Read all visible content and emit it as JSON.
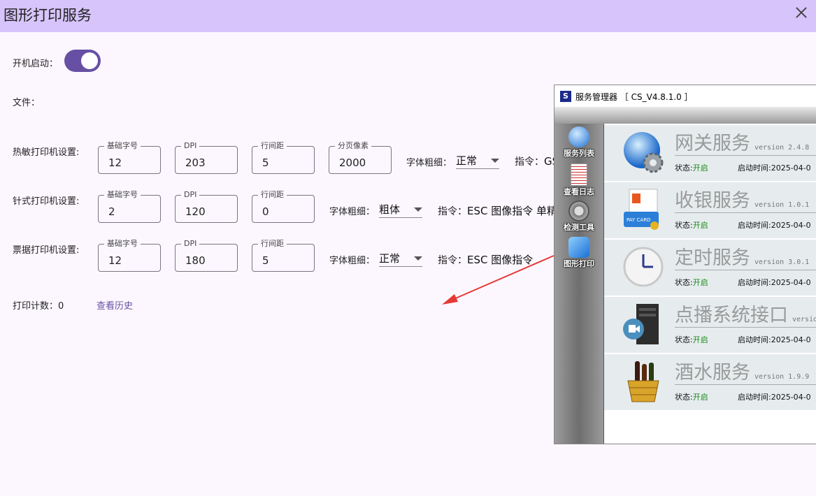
{
  "window": {
    "title": "图形打印服务"
  },
  "autostart": {
    "label": "开机启动：",
    "on": true
  },
  "file": {
    "label": "文件："
  },
  "thermal": {
    "label": "热敏打印机设置:",
    "fields": [
      {
        "label": "基础字号",
        "value": "12"
      },
      {
        "label": "DPI",
        "value": "203"
      },
      {
        "label": "行间距",
        "value": "5"
      },
      {
        "label": "分页像素",
        "value": "2000"
      }
    ],
    "weight_label": "字体粗细：",
    "weight_value": "正常",
    "cmd_label": "指令：",
    "cmd_value": "GS"
  },
  "dot": {
    "label": "针式打印机设置:",
    "fields": [
      {
        "label": "基础字号",
        "value": "2"
      },
      {
        "label": "DPI",
        "value": "120"
      },
      {
        "label": "行间距",
        "value": "0"
      }
    ],
    "weight_label": "字体粗细：",
    "weight_value": "粗体",
    "cmd_label": "指令：",
    "cmd_value": "ESC 图像指令 单精"
  },
  "receipt": {
    "label": "票据打印机设置:",
    "fields": [
      {
        "label": "基础字号",
        "value": "12"
      },
      {
        "label": "DPI",
        "value": "180"
      },
      {
        "label": "行间距",
        "value": "5"
      }
    ],
    "weight_label": "字体粗细：",
    "weight_value": "正常",
    "cmd_label": "指令：",
    "cmd_value": "ESC 图像指令"
  },
  "footer": {
    "count_label": "打印计数：0",
    "history_link": "查看历史"
  },
  "manager": {
    "title": "服务管理器 ［ CS_V4.8.1.0 ］",
    "icon_text": "S",
    "sidebar": [
      {
        "label": "服务列表",
        "icon": "globe-gear-icon"
      },
      {
        "label": "查看日志",
        "icon": "log-icon"
      },
      {
        "label": "检测工具",
        "icon": "gear-icon"
      },
      {
        "label": "图形打印",
        "icon": "print-app-icon"
      }
    ],
    "services": [
      {
        "name": "网关服务",
        "version": "version 2.4.8",
        "status_label": "状态:",
        "status": "开启",
        "time_label": "启动时间:",
        "time": "2025-04-0",
        "icon": "globe-gear-icon"
      },
      {
        "name": "收银服务",
        "version": "version 1.0.1",
        "status_label": "状态:",
        "status": "开启",
        "time_label": "启动时间:",
        "time": "2025-04-0",
        "icon": "pay-card-icon",
        "icon_text": "PAY CARD"
      },
      {
        "name": "定时服务",
        "version": "version 3.0.1",
        "status_label": "状态:",
        "status": "开启",
        "time_label": "启动时间:",
        "time": "2025-04-0",
        "icon": "clock-icon"
      },
      {
        "name": "点播系统接口",
        "version": "versio",
        "status_label": "状态:",
        "status": "开启",
        "time_label": "启动时间:",
        "time": "2025-04-0",
        "icon": "server-video-icon"
      },
      {
        "name": "酒水服务",
        "version": "version 1.9.9",
        "status_label": "状态:",
        "status": "开启",
        "time_label": "启动时间:",
        "time": "2025-04-0",
        "icon": "wine-basket-icon"
      }
    ]
  },
  "colors": {
    "accent": "#6750a4",
    "titlebar": "#d7c4fb",
    "background": "#fcf7ff",
    "status_green": "#1a8a1a",
    "arrow": "#e53935"
  }
}
